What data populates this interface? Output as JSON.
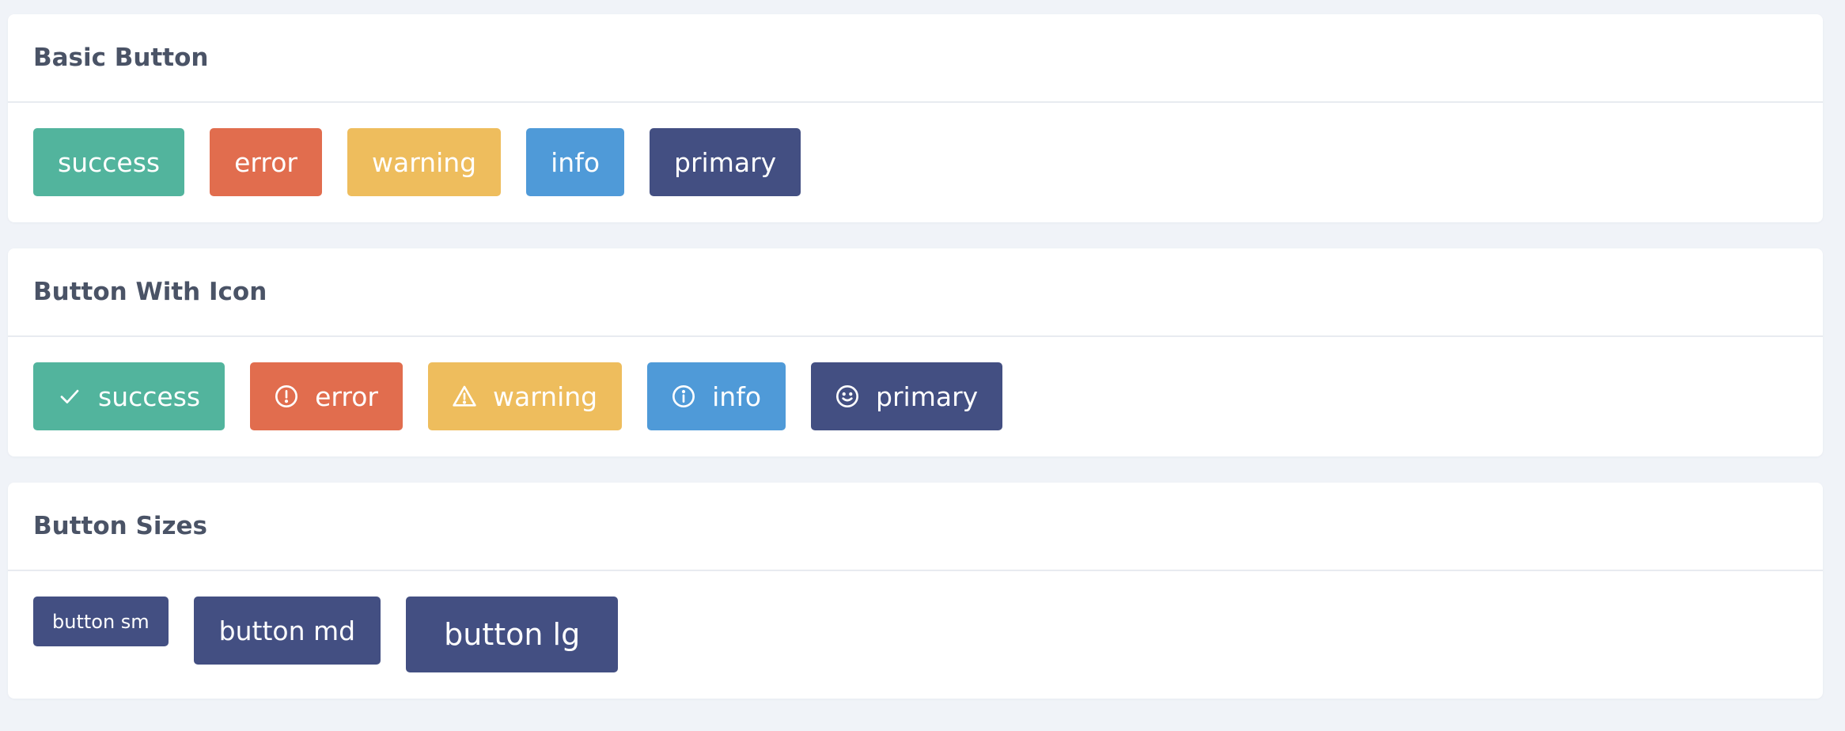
{
  "colors": {
    "success": "#52b49d",
    "error": "#e16d4e",
    "warning": "#eebd5d",
    "info": "#4f9ad8",
    "primary": "#434f82"
  },
  "basic": {
    "title": "Basic Button",
    "buttons": {
      "success": "success",
      "error": "error",
      "warning": "warning",
      "info": "info",
      "primary": "primary"
    }
  },
  "with_icon": {
    "title": "Button With Icon",
    "buttons": {
      "success": {
        "label": "success",
        "icon": "check-icon"
      },
      "error": {
        "label": "error",
        "icon": "alert-circle-icon"
      },
      "warning": {
        "label": "warning",
        "icon": "warning-triangle-icon"
      },
      "info": {
        "label": "info",
        "icon": "info-circle-icon"
      },
      "primary": {
        "label": "primary",
        "icon": "smile-icon"
      }
    }
  },
  "sizes": {
    "title": "Button Sizes",
    "buttons": {
      "sm": "button sm",
      "md": "button md",
      "lg": "button lg"
    }
  }
}
